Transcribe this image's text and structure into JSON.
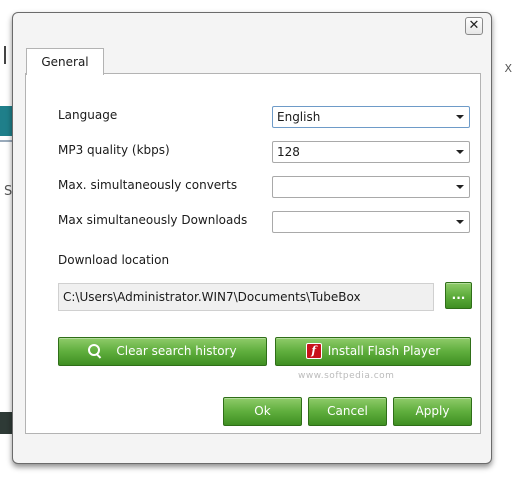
{
  "dialog": {
    "close_glyph": "✕",
    "tabs": [
      {
        "label": "General"
      }
    ],
    "settings": {
      "language": {
        "label": "Language",
        "value": "English"
      },
      "mp3_quality": {
        "label": "MP3 quality (kbps)",
        "value": "128"
      },
      "max_converts": {
        "label": "Max. simultaneously converts",
        "value": ""
      },
      "max_downloads": {
        "label": "Max simultaneously Downloads",
        "value": ""
      },
      "download_location": {
        "label": "Download location",
        "value": "C:\\Users\\Administrator.WIN7\\Documents\\TubeBox",
        "browse_label": "..."
      }
    },
    "actions": {
      "clear_history": "Clear search history",
      "install_flash": "Install Flash Player",
      "ok": "Ok",
      "cancel": "Cancel",
      "apply": "Apply"
    },
    "watermark": "www.softpedia.com",
    "watermark_logo": "SOFTPEDIA"
  },
  "background": {
    "s_letter": "S",
    "x_letter": "X"
  },
  "icons": {
    "close": "close-icon",
    "dropdown": "chevron-down-icon",
    "search": "search-icon",
    "flash": "flash-player-icon"
  },
  "colors": {
    "button_green": "#5fae3d",
    "button_border": "#2f6e18",
    "flash_red": "#c8131a",
    "focus_blue": "#6e9bc8"
  }
}
